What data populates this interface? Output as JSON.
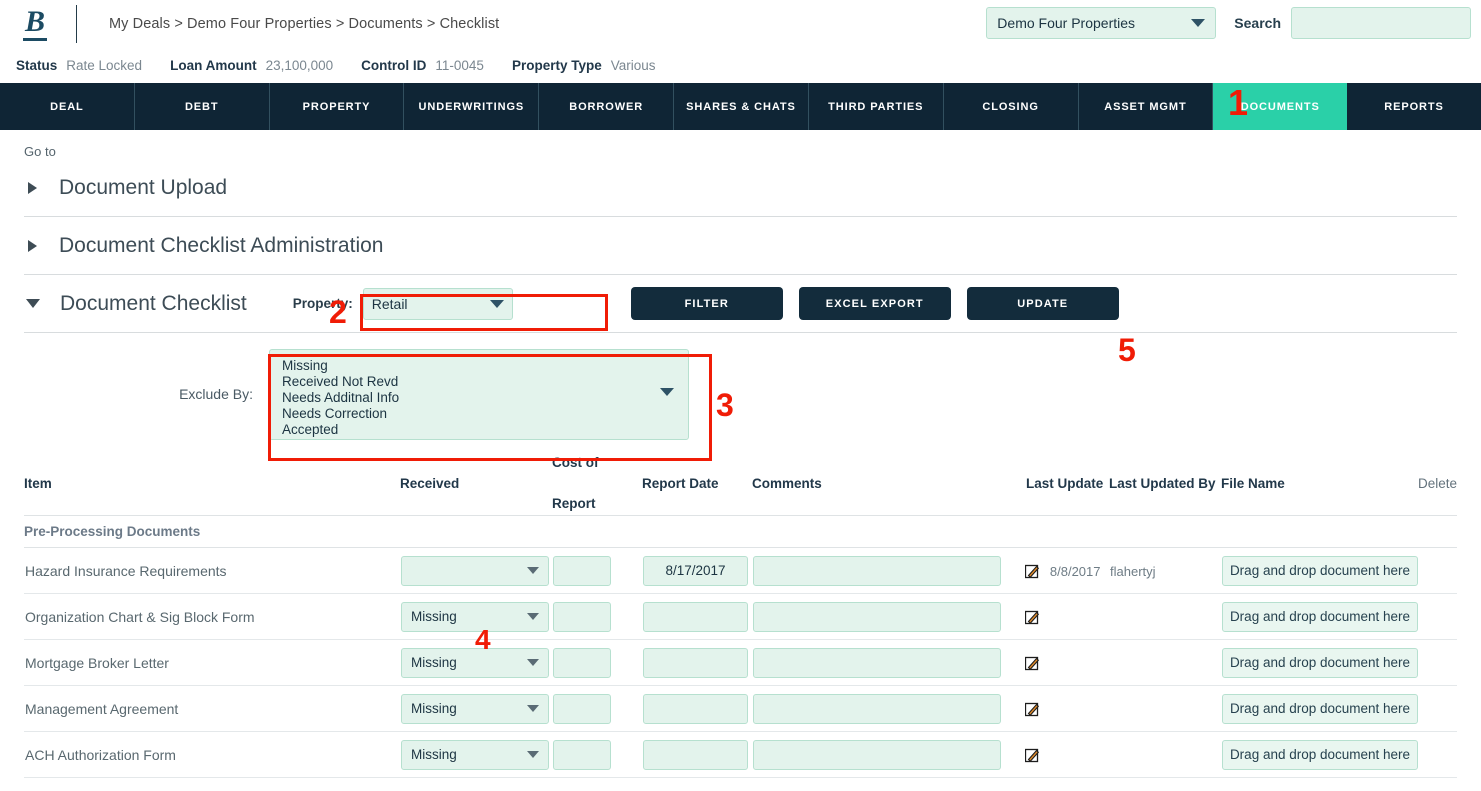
{
  "header": {
    "logo_text": "B",
    "breadcrumb": "My Deals > Demo Four Properties > Documents > Checklist",
    "deal_selector_value": "Demo Four Properties",
    "search_label": "Search",
    "search_value": "",
    "search_placeholder": ""
  },
  "status_bar": [
    {
      "key": "Status",
      "value": "Rate Locked"
    },
    {
      "key": "Loan Amount",
      "value": "23,100,000"
    },
    {
      "key": "Control ID",
      "value": "11-0045"
    },
    {
      "key": "Property Type",
      "value": "Various"
    }
  ],
  "nav": {
    "items": [
      {
        "label": "DEAL",
        "active": false
      },
      {
        "label": "DEBT",
        "active": false
      },
      {
        "label": "PROPERTY",
        "active": false
      },
      {
        "label": "UNDERWRITINGS",
        "active": false
      },
      {
        "label": "BORROWER",
        "active": false
      },
      {
        "label": "SHARES & CHATS",
        "active": false
      },
      {
        "label": "THIRD PARTIES",
        "active": false
      },
      {
        "label": "CLOSING",
        "active": false
      },
      {
        "label": "ASSET MGMT",
        "active": false
      },
      {
        "label": "DOCUMENTS",
        "active": true
      },
      {
        "label": "REPORTS",
        "active": false
      }
    ]
  },
  "main": {
    "goto_label": "Go to",
    "sections": [
      {
        "title": "Document Upload",
        "expanded": false
      },
      {
        "title": "Document Checklist Administration",
        "expanded": false
      },
      {
        "title": "Document Checklist",
        "expanded": true
      }
    ],
    "property_filter": {
      "label": "Property:",
      "value": "Retail"
    },
    "buttons": {
      "filter": "FILTER",
      "excel_export": "EXCEL EXPORT",
      "update": "UPDATE"
    },
    "exclude_by": {
      "label": "Exclude By:",
      "options": [
        "Missing",
        "Received Not Revd",
        "Needs Additnal Info",
        "Needs Correction",
        "Accepted"
      ]
    }
  },
  "table": {
    "columns": [
      "Item",
      "Received",
      "Cost of Report",
      "Report Date",
      "Comments",
      "Last Update",
      "Last Updated By",
      "File Name",
      "Delete"
    ],
    "cost_of_report_line1": "Cost of",
    "cost_of_report_line2": "Report",
    "section_title": "Pre-Processing Documents",
    "dragdrop_label": "Drag and drop document here",
    "rows": [
      {
        "item": "Hazard Insurance Requirements",
        "received": "",
        "cost": "",
        "report_date": "8/17/2017",
        "comments": "",
        "last_update": "8/8/2017",
        "last_updated_by": "flahertyj",
        "file_name": ""
      },
      {
        "item": "Organization Chart & Sig Block Form",
        "received": "Missing",
        "cost": "",
        "report_date": "",
        "comments": "",
        "last_update": "",
        "last_updated_by": "",
        "file_name": ""
      },
      {
        "item": "Mortgage Broker Letter",
        "received": "Missing",
        "cost": "",
        "report_date": "",
        "comments": "",
        "last_update": "",
        "last_updated_by": "",
        "file_name": ""
      },
      {
        "item": "Management Agreement",
        "received": "Missing",
        "cost": "",
        "report_date": "",
        "comments": "",
        "last_update": "",
        "last_updated_by": "",
        "file_name": ""
      },
      {
        "item": "ACH Authorization Form",
        "received": "Missing",
        "cost": "",
        "report_date": "",
        "comments": "",
        "last_update": "",
        "last_updated_by": "",
        "file_name": ""
      }
    ]
  },
  "annotations": [
    {
      "number": "1"
    },
    {
      "number": "2"
    },
    {
      "number": "3"
    },
    {
      "number": "4"
    },
    {
      "number": "5"
    }
  ],
  "colors": {
    "accent_teal": "#2ad0a8",
    "nav_dark": "#0f2535",
    "button_dark": "#132c3c",
    "field_mint": "#e3f3ec",
    "field_border": "#b6e0cf",
    "annotation_red": "#f01c06"
  }
}
